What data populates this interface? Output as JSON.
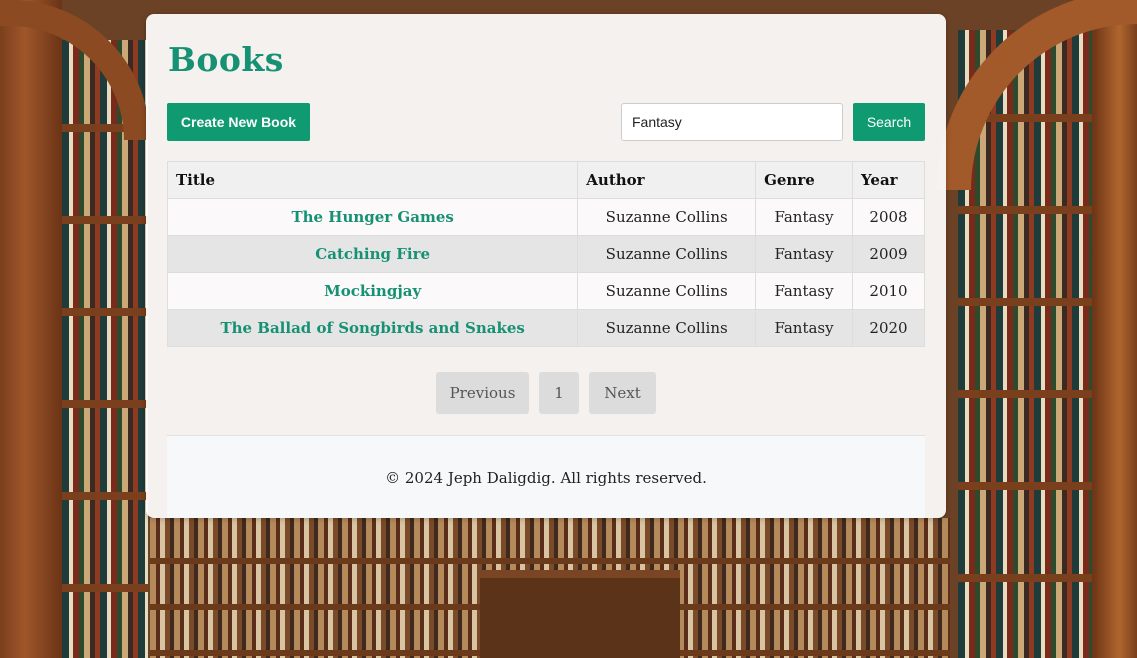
{
  "page": {
    "title": "Books"
  },
  "toolbar": {
    "create_label": "Create New Book",
    "search_value": "Fantasy",
    "search_label": "Search"
  },
  "table": {
    "headers": [
      "Title",
      "Author",
      "Genre",
      "Year"
    ],
    "rows": [
      {
        "title": "The Hunger Games",
        "author": "Suzanne Collins",
        "genre": "Fantasy",
        "year": "2008"
      },
      {
        "title": "Catching Fire",
        "author": "Suzanne Collins",
        "genre": "Fantasy",
        "year": "2009"
      },
      {
        "title": "Mockingjay",
        "author": "Suzanne Collins",
        "genre": "Fantasy",
        "year": "2010"
      },
      {
        "title": "The Ballad of Songbirds and Snakes",
        "author": "Suzanne Collins",
        "genre": "Fantasy",
        "year": "2020"
      }
    ]
  },
  "pagination": {
    "previous_label": "Previous",
    "current_page": "1",
    "next_label": "Next"
  },
  "footer": {
    "text": "© 2024 Jeph Daligdig. All rights reserved."
  },
  "colors": {
    "accent": "#0f9a72",
    "link": "#179174"
  }
}
